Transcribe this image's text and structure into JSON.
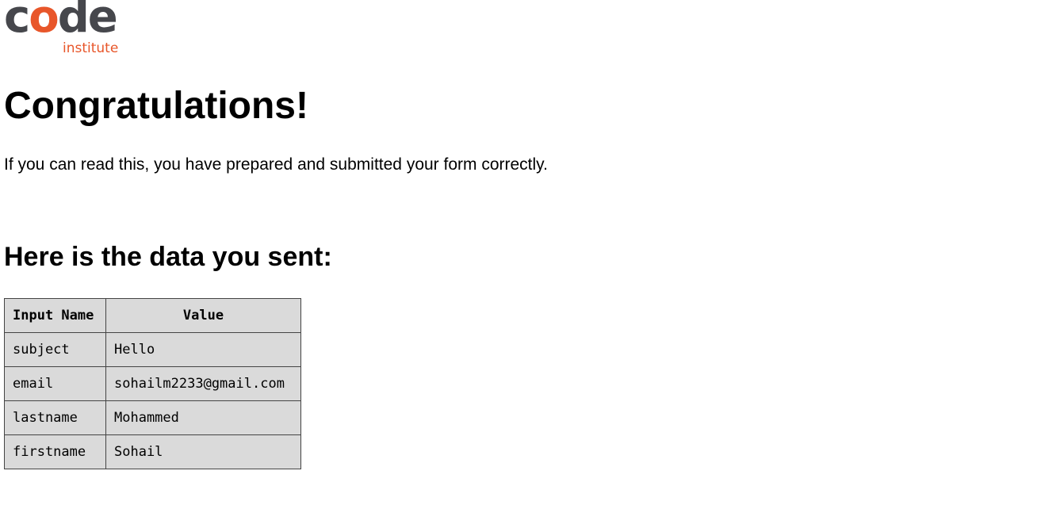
{
  "logo": {
    "word_before": "c",
    "word_accent": "o",
    "word_after": "de",
    "sub": "institute",
    "colors": {
      "dark": "#46474c",
      "accent": "#e8562a"
    }
  },
  "page": {
    "title": "Congratulations!",
    "intro": "If you can read this, you have prepared and submitted your form correctly.",
    "subtitle": "Here is the data you sent:"
  },
  "table": {
    "headers": [
      "Input Name",
      "Value"
    ],
    "rows": [
      {
        "name": "subject",
        "value": "Hello"
      },
      {
        "name": "email",
        "value": "sohailm2233@gmail.com"
      },
      {
        "name": "lastname",
        "value": "Mohammed"
      },
      {
        "name": "firstname",
        "value": "Sohail"
      }
    ],
    "cell_background": "#dadada"
  }
}
